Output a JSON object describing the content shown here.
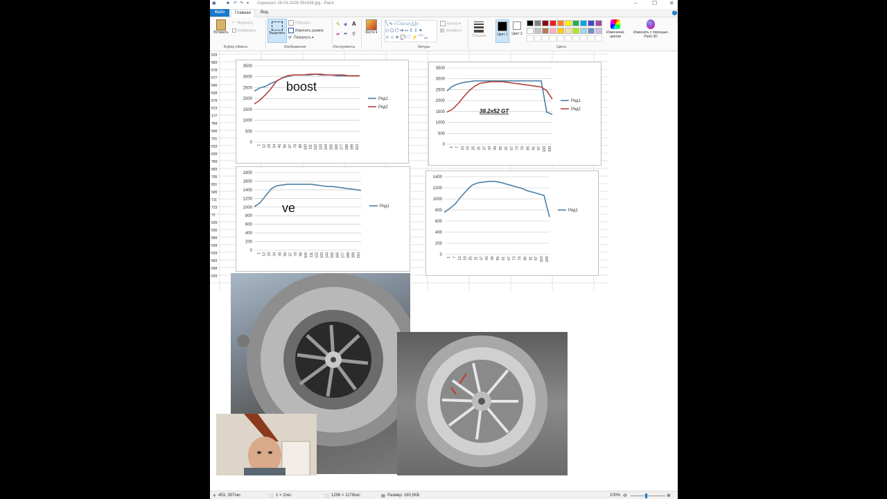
{
  "window": {
    "title": "Скриншот 28-03-2026 091638.jpg - Paint"
  },
  "tabs": [
    {
      "label": "Файл"
    },
    {
      "label": "Главная"
    },
    {
      "label": "Вид"
    }
  ],
  "ribbon": {
    "clipboard": {
      "paste": "Вставить",
      "cut": "Вырезать",
      "copy": "Копировать",
      "label": "Буфер обмена"
    },
    "image": {
      "select": "Выделить",
      "crop": "Обрезать",
      "resize": "Изменить размер",
      "rotate": "Повернуть",
      "label": "Изображение"
    },
    "tools": {
      "label": "Инструменты",
      "brushes": "Кисти"
    },
    "shapes": {
      "label": "Фигуры",
      "outline": "Контур",
      "fill": "Заливка"
    },
    "size": {
      "label": "Толщина"
    },
    "colors": {
      "color1": "Цвет 1",
      "color2": "Цвет 2",
      "edit": "Изменение цветов",
      "paint3d": "Изменить с помощью Paint 3D",
      "label": "Цвета",
      "palette_row1": [
        "#000000",
        "#7f7f7f",
        "#880015",
        "#ed1c24",
        "#ff7f27",
        "#fff200",
        "#22b14c",
        "#00a2e8",
        "#3f48cc",
        "#a349a4"
      ],
      "palette_row2": [
        "#ffffff",
        "#c3c3c3",
        "#b97a57",
        "#ffaec9",
        "#ffc90e",
        "#efe4b0",
        "#b5e61d",
        "#99d9ea",
        "#7092be",
        "#c8bfe7"
      ]
    }
  },
  "row_numbers": [
    "629",
    "683",
    "678",
    "677",
    "645",
    "628",
    "579",
    "573",
    "177",
    "784",
    "606",
    "701",
    "633",
    "628",
    "789",
    "683",
    "705",
    "651",
    "645",
    "711",
    "723",
    "72",
    "639",
    "636",
    "689",
    "628",
    "629",
    "683",
    "668",
    "633"
  ],
  "charts": [
    {
      "annotation": "boost",
      "legend": [
        "Ряд1",
        "Ряд2"
      ],
      "colors": [
        "#4a7ea5",
        "#b0413e"
      ],
      "yticks": [
        "3500",
        "3000",
        "2500",
        "2000",
        "1500",
        "1000",
        "500",
        "0"
      ],
      "xticks": [
        "1",
        "12",
        "23",
        "34",
        "45",
        "56",
        "67",
        "78",
        "89",
        "100",
        "111",
        "122",
        "133",
        "144",
        "155",
        "166",
        "177",
        "188",
        "199",
        "210"
      ]
    },
    {
      "annotation": "38.2x52 GT",
      "legend": [
        "Ряд1",
        "Ряд2"
      ],
      "colors": [
        "#4a7ea5",
        "#b0413e"
      ],
      "yticks": [
        "3500",
        "3000",
        "2500",
        "2000",
        "1500",
        "1000",
        "500",
        "0"
      ],
      "xticks": [
        "1",
        "7",
        "13",
        "19",
        "25",
        "31",
        "37",
        "43",
        "49",
        "55",
        "61",
        "67",
        "73",
        "79",
        "85",
        "91",
        "97",
        "103",
        "109"
      ]
    },
    {
      "annotation": "ve",
      "legend": [
        "Ряд1"
      ],
      "colors": [
        "#4a7ea5"
      ],
      "yticks": [
        "1800",
        "1600",
        "1400",
        "1200",
        "1000",
        "800",
        "600",
        "400",
        "200",
        "0"
      ],
      "xticks": [
        "1",
        "12",
        "23",
        "34",
        "45",
        "56",
        "67",
        "78",
        "89",
        "100",
        "111",
        "122",
        "133",
        "144",
        "155",
        "166",
        "177",
        "188",
        "199",
        "210"
      ]
    },
    {
      "annotation": "",
      "legend": [
        "Ряд1"
      ],
      "colors": [
        "#4a7ea5"
      ],
      "yticks": [
        "1400",
        "1200",
        "1000",
        "800",
        "600",
        "400",
        "200",
        "0"
      ],
      "xticks": [
        "1",
        "7",
        "13",
        "19",
        "25",
        "31",
        "37",
        "43",
        "49",
        "55",
        "61",
        "67",
        "73",
        "79",
        "85",
        "91",
        "97",
        "103",
        "109"
      ]
    }
  ],
  "status": {
    "cursor": "453, 397пкс",
    "selection": "1 × 2пкс",
    "dimensions": "1296 × 1178пкс",
    "size": "Размер: 160,5КБ",
    "zoom": "100%"
  }
}
